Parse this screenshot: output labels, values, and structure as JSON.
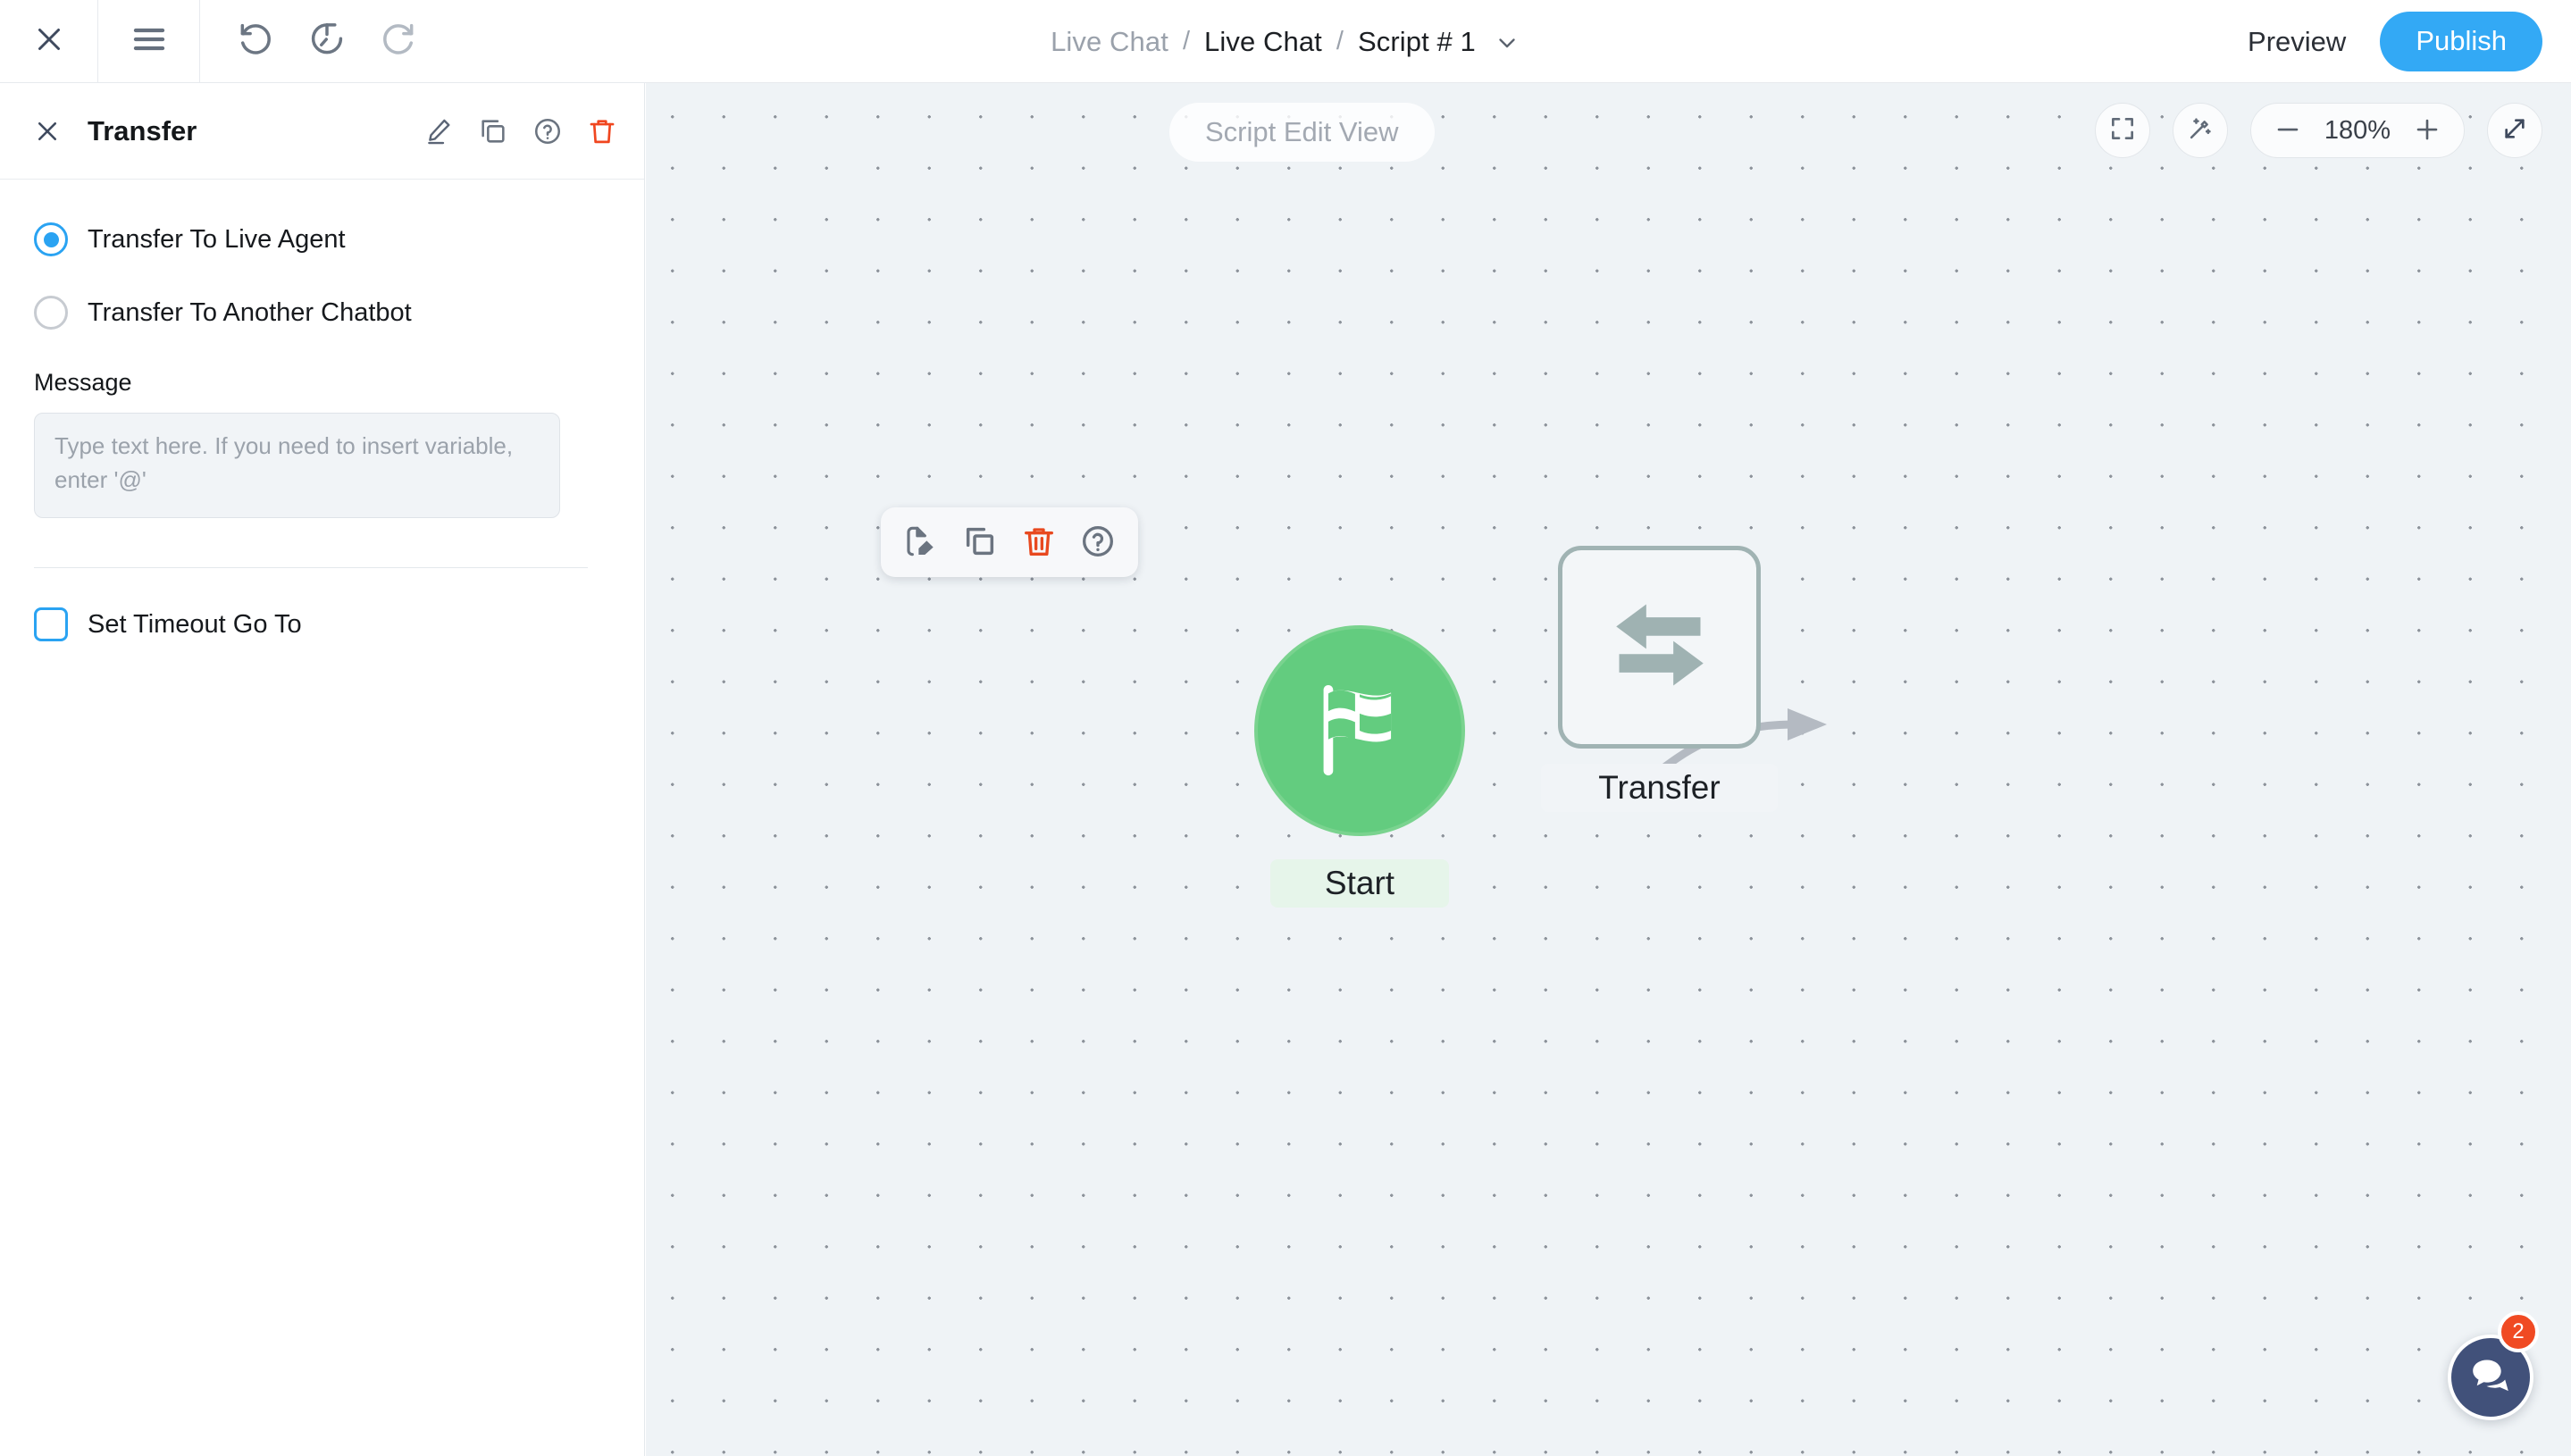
{
  "topbar": {
    "close_icon": "close-icon",
    "menu_icon": "hamburger-menu-icon",
    "undo_icon": "undo-icon",
    "history_icon": "history-restore-icon",
    "redo_icon": "redo-icon",
    "breadcrumb": [
      {
        "label": "Live Chat",
        "muted": true
      },
      {
        "label": "Live Chat",
        "muted": false
      },
      {
        "label": "Script # 1",
        "muted": false
      }
    ],
    "separator": "/",
    "caret_icon": "chevron-down-icon",
    "preview_label": "Preview",
    "publish_label": "Publish",
    "publish_color": "#33a9f5"
  },
  "panel": {
    "title": "Transfer",
    "close_icon": "close-icon",
    "actions": [
      {
        "name": "edit-icon",
        "color": "#5a6475"
      },
      {
        "name": "duplicate-icon",
        "color": "#6b7480"
      },
      {
        "name": "help-icon",
        "color": "#6b7480"
      },
      {
        "name": "delete-icon",
        "color": "#f0461f"
      }
    ],
    "options": [
      {
        "label": "Transfer To Live Agent",
        "selected": true
      },
      {
        "label": "Transfer To Another Chatbot",
        "selected": false
      }
    ],
    "message_label": "Message",
    "message_value": "",
    "message_placeholder": "Type text here. If you need to insert variable, enter '@'",
    "timeout_label": "Set Timeout Go To",
    "timeout_checked": false,
    "accent_color": "#2aa3f2"
  },
  "canvas": {
    "view_label": "Script Edit View",
    "background_color": "#eff3f6",
    "tools": {
      "fit_icon": "fit-to-screen-icon",
      "magic_icon": "magic-wand-icon",
      "zoom_out_icon": "minus-icon",
      "zoom_level": "180%",
      "zoom_in_icon": "plus-icon",
      "expand_icon": "expand-diagonal-icon"
    },
    "node_toolbar": [
      {
        "name": "edit-node-icon",
        "color": "#6b7480"
      },
      {
        "name": "duplicate-node-icon",
        "color": "#6b7480"
      },
      {
        "name": "delete-node-icon",
        "color": "#e8491f"
      },
      {
        "name": "help-node-icon",
        "color": "#6b7480"
      }
    ],
    "nodes": [
      {
        "id": "start",
        "label": "Start",
        "icon": "checkered-flag-icon",
        "color": "#63cc7f"
      },
      {
        "id": "transfer",
        "label": "Transfer",
        "icon": "transfer-arrows-icon",
        "color": "#a0b3b3"
      }
    ],
    "connector_color": "#b4bac2"
  },
  "fab": {
    "icon": "chat-bubbles-icon",
    "badge": "2",
    "color": "#41517a",
    "badge_color": "#f04a23"
  }
}
